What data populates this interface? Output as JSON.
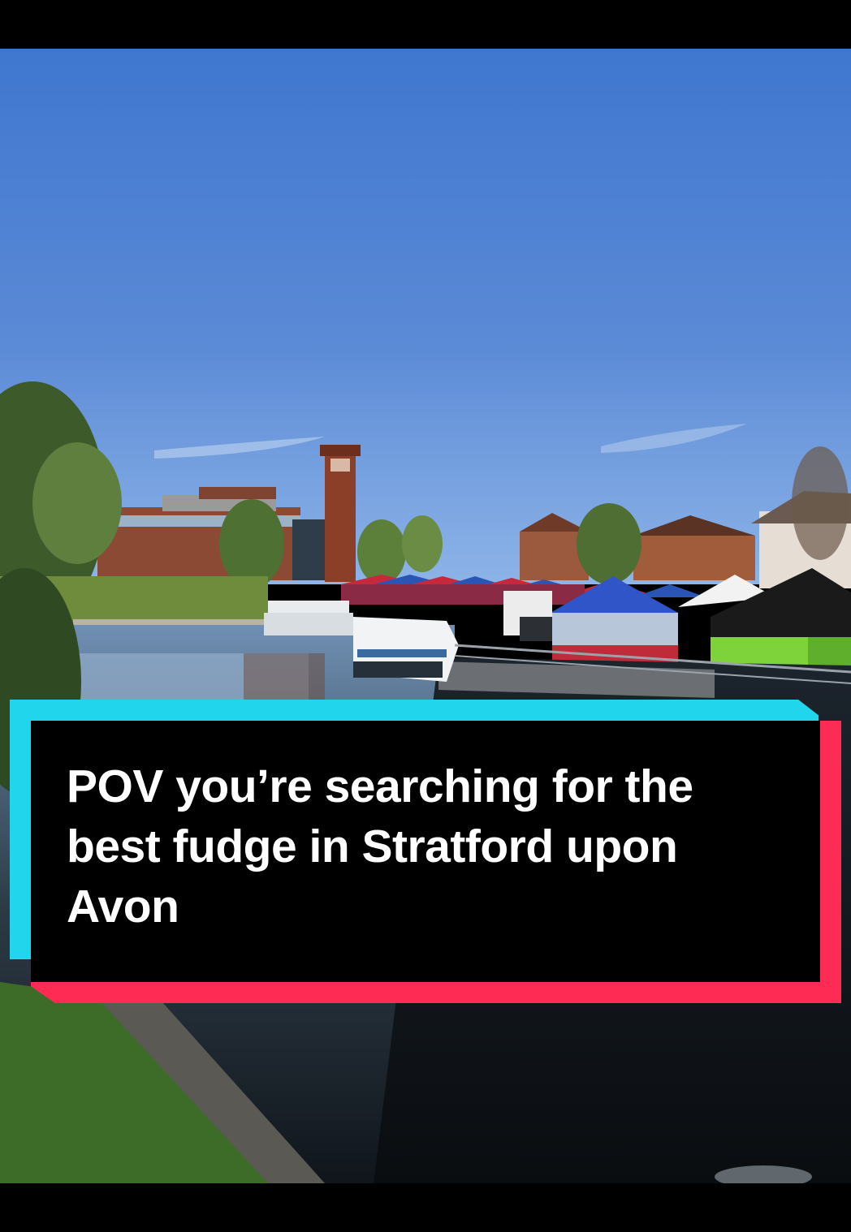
{
  "caption": {
    "text": "POV you’re searching for the best fudge in Stratford upon Avon"
  },
  "colors": {
    "caption_bg": "#000000",
    "caption_text": "#ffffff",
    "accent_cyan": "#20d5ec",
    "accent_red": "#fe2c55",
    "sky": "#5b8ad6"
  }
}
